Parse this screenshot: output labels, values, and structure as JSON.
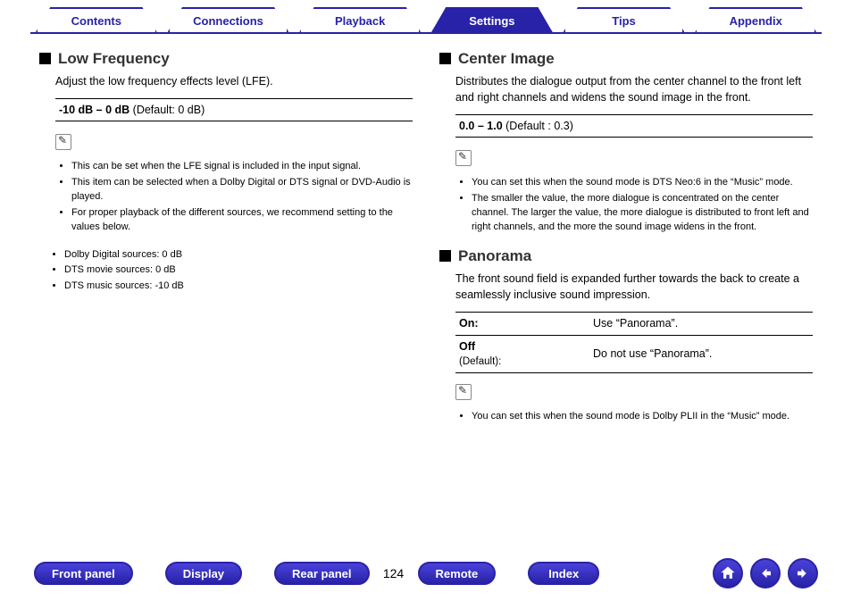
{
  "tabs": [
    "Contents",
    "Connections",
    "Playback",
    "Settings",
    "Tips",
    "Appendix"
  ],
  "activeTab": 3,
  "left": {
    "lowFreq": {
      "title": "Low Frequency",
      "desc": "Adjust the low frequency effects level (LFE).",
      "range": "-10 dB – 0 dB",
      "default": " (Default: 0 dB)",
      "notes": [
        "This can be set when the LFE signal is included in the input signal.",
        "This item can be selected when a Dolby Digital or DTS signal or DVD-Audio is played.",
        "For proper playback of the different sources, we recommend setting to the values below."
      ],
      "subnotes": [
        "Dolby Digital sources: 0 dB",
        "DTS movie sources: 0 dB",
        "DTS music sources: -10 dB"
      ]
    }
  },
  "right": {
    "centerImage": {
      "title": "Center Image",
      "desc": "Distributes the dialogue output from the center channel to the front left and right channels and widens the sound image in the front.",
      "range": "0.0 – 1.0",
      "default": " (Default : 0.3)",
      "notes": [
        "You can set this when the sound mode is DTS Neo:6 in the “Music” mode.",
        "The smaller the value, the more dialogue is concentrated on the center channel. The larger the value, the more dialogue is distributed to front left and right channels, and the more the sound image widens in the front."
      ]
    },
    "panorama": {
      "title": "Panorama",
      "desc": "The front sound field is expanded further towards the back to create a seamlessly inclusive sound impression.",
      "options": [
        {
          "label": "On:",
          "def": "",
          "val": "Use “Panorama”."
        },
        {
          "label": "Off",
          "def": "(Default):",
          "val": "Do not use “Panorama”."
        }
      ],
      "notes": [
        "You can set this when the sound mode is Dolby PLII in the “Music” mode."
      ]
    }
  },
  "footer": {
    "buttons": [
      "Front panel",
      "Display",
      "Rear panel"
    ],
    "page": "124",
    "buttons2": [
      "Remote",
      "Index"
    ]
  }
}
